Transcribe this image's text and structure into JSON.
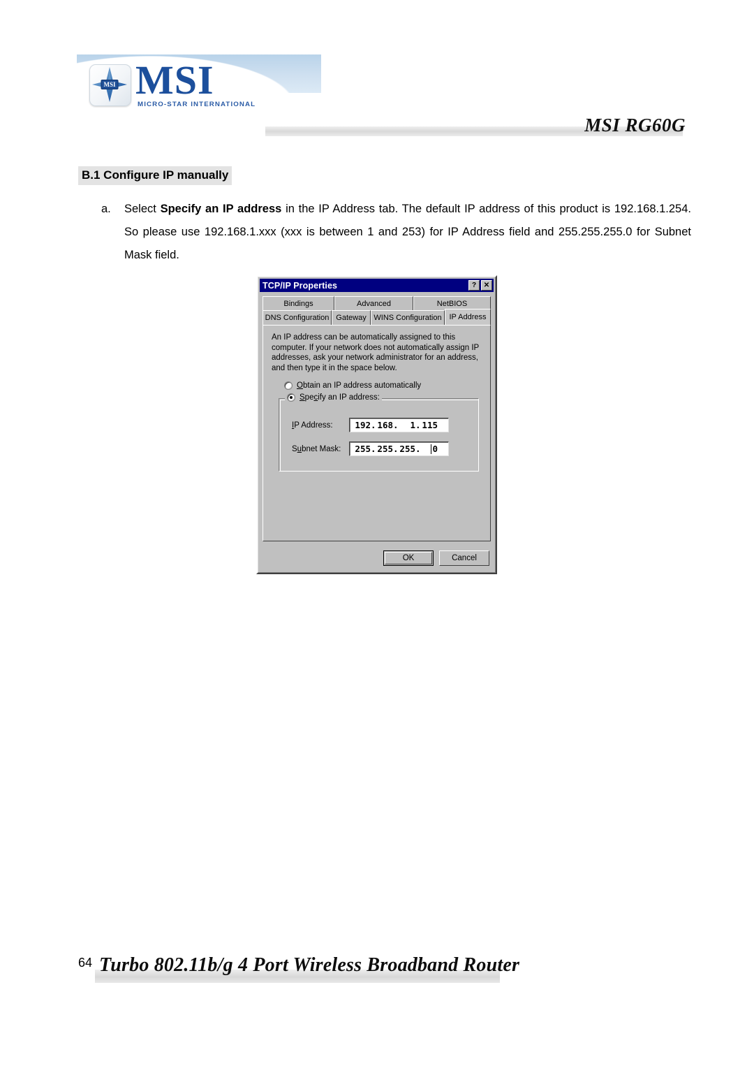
{
  "header": {
    "logo_word": "MSI",
    "logo_tagline": "MICRO-STAR INTERNATIONAL",
    "logo_badge_text": "MSI",
    "product_title": "MSI RG60G"
  },
  "section": {
    "heading": "B.1 Configure IP manually"
  },
  "paragraph": {
    "marker": "a.",
    "part1": "Select ",
    "bold": "Specify an IP address",
    "part2": " in the IP Address tab. The default IP address of this product is 192.168.1.254. So please use 192.168.1.xxx (xxx is between 1 and 253) for IP Address field and 255.255.255.0 for Subnet Mask field."
  },
  "dialog": {
    "title": "TCP/IP Properties",
    "help_button": "?",
    "close_button": "✕",
    "tabs_row1": [
      {
        "label": "Bindings",
        "active": false
      },
      {
        "label": "Advanced",
        "active": false
      },
      {
        "label": "NetBIOS",
        "active": false
      }
    ],
    "tabs_row2": [
      {
        "label": "DNS Configuration",
        "active": false
      },
      {
        "label": "Gateway",
        "active": false
      },
      {
        "label": "WINS Configuration",
        "active": false
      },
      {
        "label": "IP Address",
        "active": true
      }
    ],
    "description": "An IP address can be automatically assigned to this computer. If your network does not automatically assign IP addresses, ask your network administrator for an address, and then type it in the space below.",
    "radio_obtain": {
      "label_accel": "O",
      "label_rest": "btain an IP address automatically",
      "checked": false
    },
    "radio_specify": {
      "label_accel": "S",
      "label_mid": "pe",
      "label_accel2": "c",
      "label_rest": "ify an IP address:",
      "checked": true
    },
    "ip_address": {
      "label_accel": "I",
      "label_rest": "P Address:",
      "octet1": "192",
      "octet2": "168",
      "octet3": "1",
      "octet4": "115"
    },
    "subnet_mask": {
      "label_pre": "S",
      "label_accel": "u",
      "label_rest": "bnet Mask:",
      "octet1": "255",
      "octet2": "255",
      "octet3": "255",
      "octet4": "0"
    },
    "ok_button": "OK",
    "cancel_button": "Cancel"
  },
  "footer": {
    "page_number": "64",
    "title": "Turbo 802.11b/g 4 Port Wireless Broadband Router"
  },
  "colors": {
    "titlebar_blue": "#000080",
    "dialog_face": "#c0c0c0",
    "brand_blue": "#1c4f9c",
    "swoosh_blue": "#c3d9ec"
  }
}
